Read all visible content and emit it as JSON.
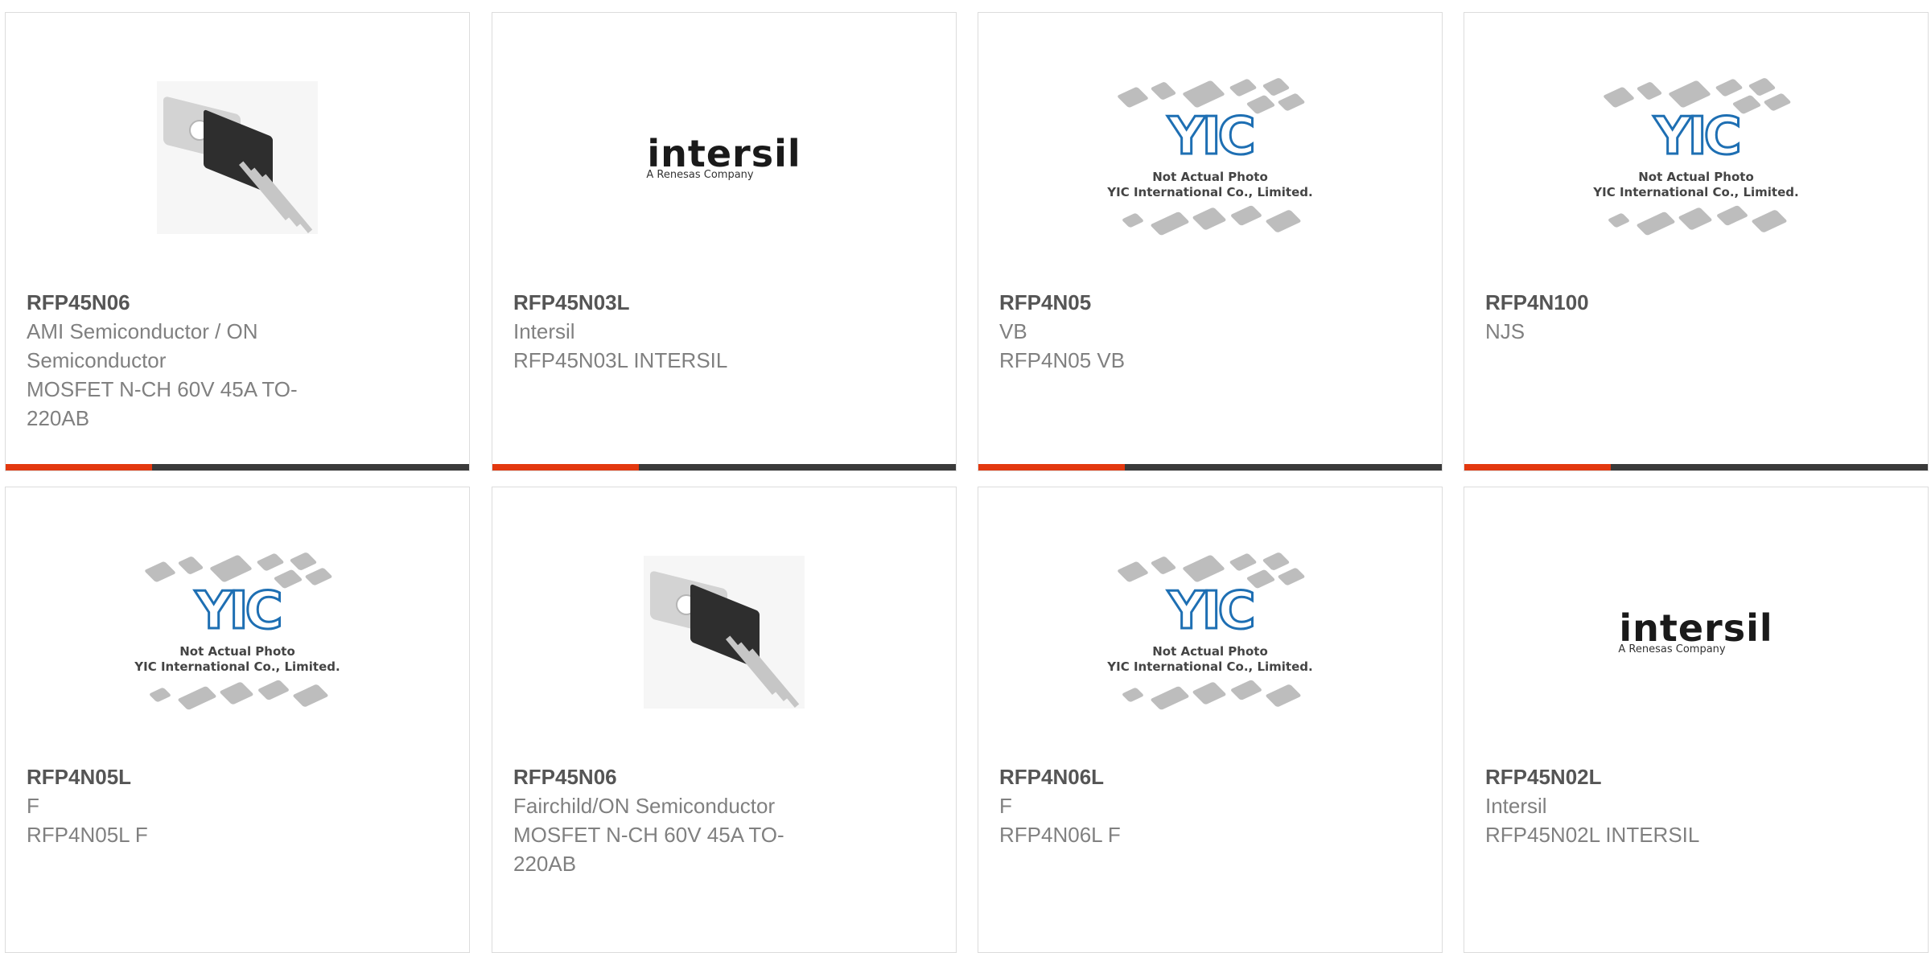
{
  "cards": [
    {
      "part": "RFP45N06",
      "lines": [
        "AMI Semiconductor / ON",
        "Semiconductor",
        "MOSFET N-CH 60V 45A TO-",
        "220AB"
      ],
      "image": "to220-transistor"
    },
    {
      "part": "RFP45N03L",
      "lines": [
        "Intersil",
        "RFP45N03L INTERSIL"
      ],
      "image": "intersil-logo"
    },
    {
      "part": "RFP4N05",
      "lines": [
        "VB",
        "RFP4N05 VB"
      ],
      "image": "yic-placeholder"
    },
    {
      "part": "RFP4N100",
      "lines": [
        "NJS"
      ],
      "image": "yic-placeholder"
    },
    {
      "part": "RFP4N05L",
      "lines": [
        "F",
        "RFP4N05L F"
      ],
      "image": "yic-placeholder"
    },
    {
      "part": "RFP45N06",
      "lines": [
        "Fairchild/ON Semiconductor",
        "MOSFET N-CH 60V 45A TO-",
        "220AB"
      ],
      "image": "to220-transistor"
    },
    {
      "part": "RFP4N06L",
      "lines": [
        "F",
        "RFP4N06L F"
      ],
      "image": "yic-placeholder"
    },
    {
      "part": "RFP45N02L",
      "lines": [
        "Intersil",
        "RFP45N02L INTERSIL"
      ],
      "image": "intersil-logo"
    }
  ],
  "logo": {
    "brand": "intersil",
    "tagline": "A Renesas Company"
  },
  "placeholder": {
    "mark": "YIC",
    "caption_line1": "Not Actual Photo",
    "caption_line2": "YIC International Co., Limited."
  },
  "colors": {
    "accent": "#e3380f",
    "bar": "#3a3a3a",
    "part_text": "#555555",
    "body_text": "#808080",
    "border": "#dcdcdc"
  }
}
